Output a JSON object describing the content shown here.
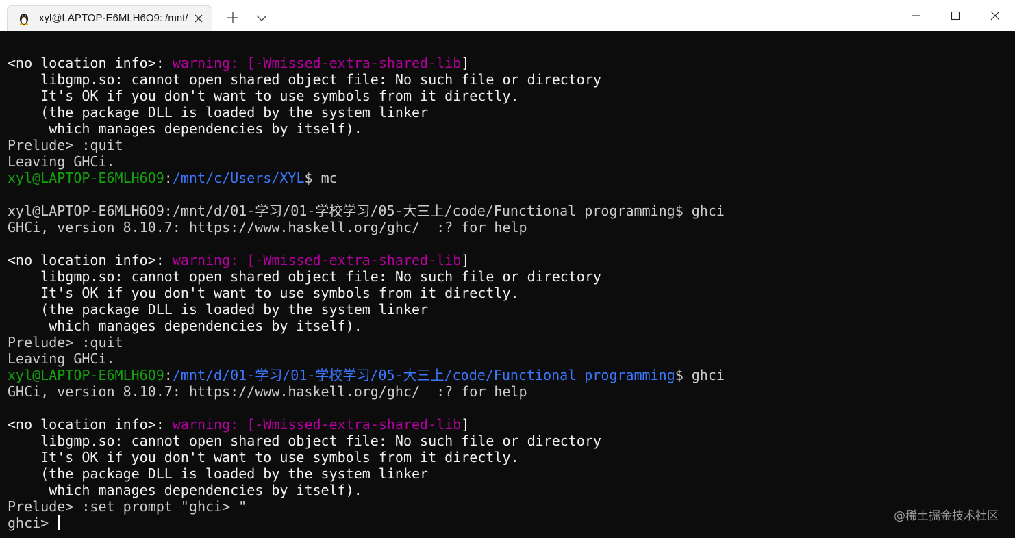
{
  "window": {
    "tab_title": "xyl@LAPTOP-E6MLH6O9: /mnt/",
    "tab_icon": "linux-tux-icon",
    "controls": [
      "minimize-icon",
      "maximize-icon",
      "close-icon"
    ]
  },
  "colors": {
    "background": "#0c0c0c",
    "text": "#cccccc",
    "warning": "#b4009e",
    "user": "#13a10e",
    "path": "#3b78ff"
  },
  "terminal": {
    "lines": [
      [
        {
          "t": "<no location info>: ",
          "c": "white"
        },
        {
          "t": "warning: [-Wmissed-extra-shared-lib",
          "c": "warn"
        },
        {
          "t": "]",
          "c": "white"
        }
      ],
      [
        {
          "t": "    libgmp.so: cannot open shared object file: No such file or directory",
          "c": "white"
        }
      ],
      [
        {
          "t": "    It's OK if you don't want to use symbols from it directly.",
          "c": "white"
        }
      ],
      [
        {
          "t": "    (the package DLL is loaded by the system linker",
          "c": "white"
        }
      ],
      [
        {
          "t": "     which manages dependencies by itself).",
          "c": "white"
        }
      ],
      [
        {
          "t": "Prelude> :quit",
          "c": "default"
        }
      ],
      [
        {
          "t": "Leaving GHCi.",
          "c": "default"
        }
      ],
      [
        {
          "t": "xyl@LAPTOP-E6MLH6O9",
          "c": "user"
        },
        {
          "t": ":",
          "c": "default"
        },
        {
          "t": "/mnt/c/Users/XYL",
          "c": "path"
        },
        {
          "t": "$ mc",
          "c": "default"
        }
      ],
      [
        {
          "t": "",
          "c": "default"
        }
      ],
      [
        {
          "t": "xyl@LAPTOP-E6MLH6O9:/mnt/d/01-学习/01-学校学习/05-大三上/code/Functional programming$ ghci",
          "c": "default"
        }
      ],
      [
        {
          "t": "GHCi, version 8.10.7: https://www.haskell.org/ghc/  :? for help",
          "c": "default"
        }
      ],
      [
        {
          "t": "",
          "c": "default"
        }
      ],
      [
        {
          "t": "<no location info>: ",
          "c": "white"
        },
        {
          "t": "warning: [-Wmissed-extra-shared-lib",
          "c": "warn"
        },
        {
          "t": "]",
          "c": "white"
        }
      ],
      [
        {
          "t": "    libgmp.so: cannot open shared object file: No such file or directory",
          "c": "white"
        }
      ],
      [
        {
          "t": "    It's OK if you don't want to use symbols from it directly.",
          "c": "white"
        }
      ],
      [
        {
          "t": "    (the package DLL is loaded by the system linker",
          "c": "white"
        }
      ],
      [
        {
          "t": "     which manages dependencies by itself).",
          "c": "white"
        }
      ],
      [
        {
          "t": "Prelude> :quit",
          "c": "default"
        }
      ],
      [
        {
          "t": "Leaving GHCi.",
          "c": "default"
        }
      ],
      [
        {
          "t": "xyl@LAPTOP-E6MLH6O9",
          "c": "user"
        },
        {
          "t": ":",
          "c": "default"
        },
        {
          "t": "/mnt/d/01-学习/01-学校学习/05-大三上/code/Functional programming",
          "c": "path"
        },
        {
          "t": "$ ghci",
          "c": "default"
        }
      ],
      [
        {
          "t": "GHCi, version 8.10.7: https://www.haskell.org/ghc/  :? for help",
          "c": "default"
        }
      ],
      [
        {
          "t": "",
          "c": "default"
        }
      ],
      [
        {
          "t": "<no location info>: ",
          "c": "white"
        },
        {
          "t": "warning: [-Wmissed-extra-shared-lib",
          "c": "warn"
        },
        {
          "t": "]",
          "c": "white"
        }
      ],
      [
        {
          "t": "    libgmp.so: cannot open shared object file: No such file or directory",
          "c": "white"
        }
      ],
      [
        {
          "t": "    It's OK if you don't want to use symbols from it directly.",
          "c": "white"
        }
      ],
      [
        {
          "t": "    (the package DLL is loaded by the system linker",
          "c": "white"
        }
      ],
      [
        {
          "t": "     which manages dependencies by itself).",
          "c": "white"
        }
      ],
      [
        {
          "t": "Prelude> :set prompt \"ghci> \"",
          "c": "default"
        }
      ],
      [
        {
          "t": "ghci> ",
          "c": "default"
        }
      ]
    ],
    "cursor_line": 28
  },
  "watermark": "@稀土掘金技术社区"
}
